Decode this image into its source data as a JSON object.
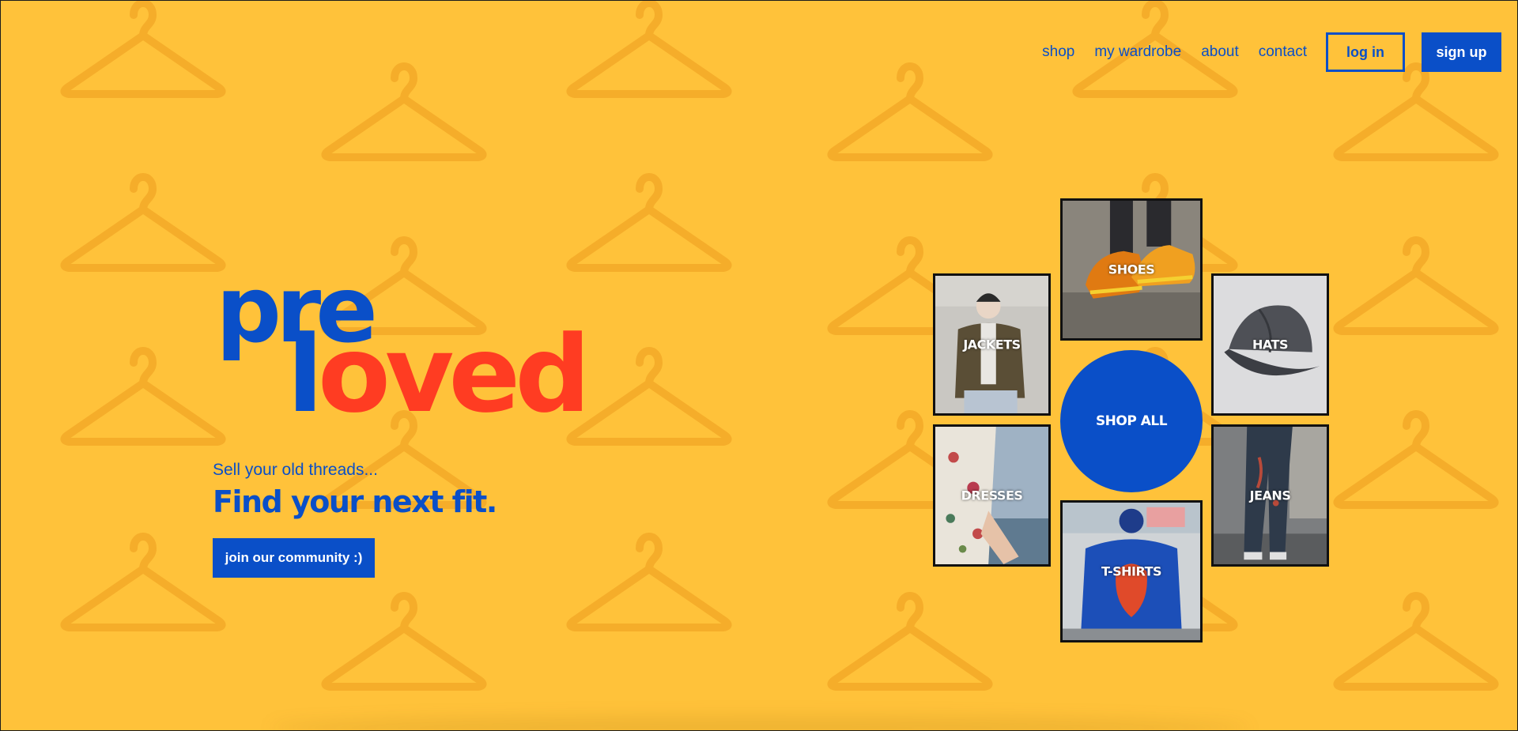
{
  "nav": {
    "links": [
      "shop",
      "my wardrobe",
      "about",
      "contact"
    ],
    "login_label": "log in",
    "signup_label": "sign up"
  },
  "hero": {
    "logo_pre": "pre",
    "logo_l": "l",
    "logo_oved": "oved",
    "tagline": "Sell your old threads...",
    "headline": "Find your next fit.",
    "cta_label": "join our community :)"
  },
  "categories": {
    "shoes": "SHOES",
    "jackets": "JACKETS",
    "hats": "HATS",
    "shop_all": "SHOP ALL",
    "dresses": "DRESSES",
    "jeans": "JEANS",
    "tshirts": "T-SHIRTS"
  },
  "colors": {
    "background": "#ffc23a",
    "brand_blue": "#0a4fc8",
    "brand_red": "#ff3c22",
    "tile_border": "#111111"
  },
  "icons": {
    "background_pattern": "hanger-icon"
  }
}
